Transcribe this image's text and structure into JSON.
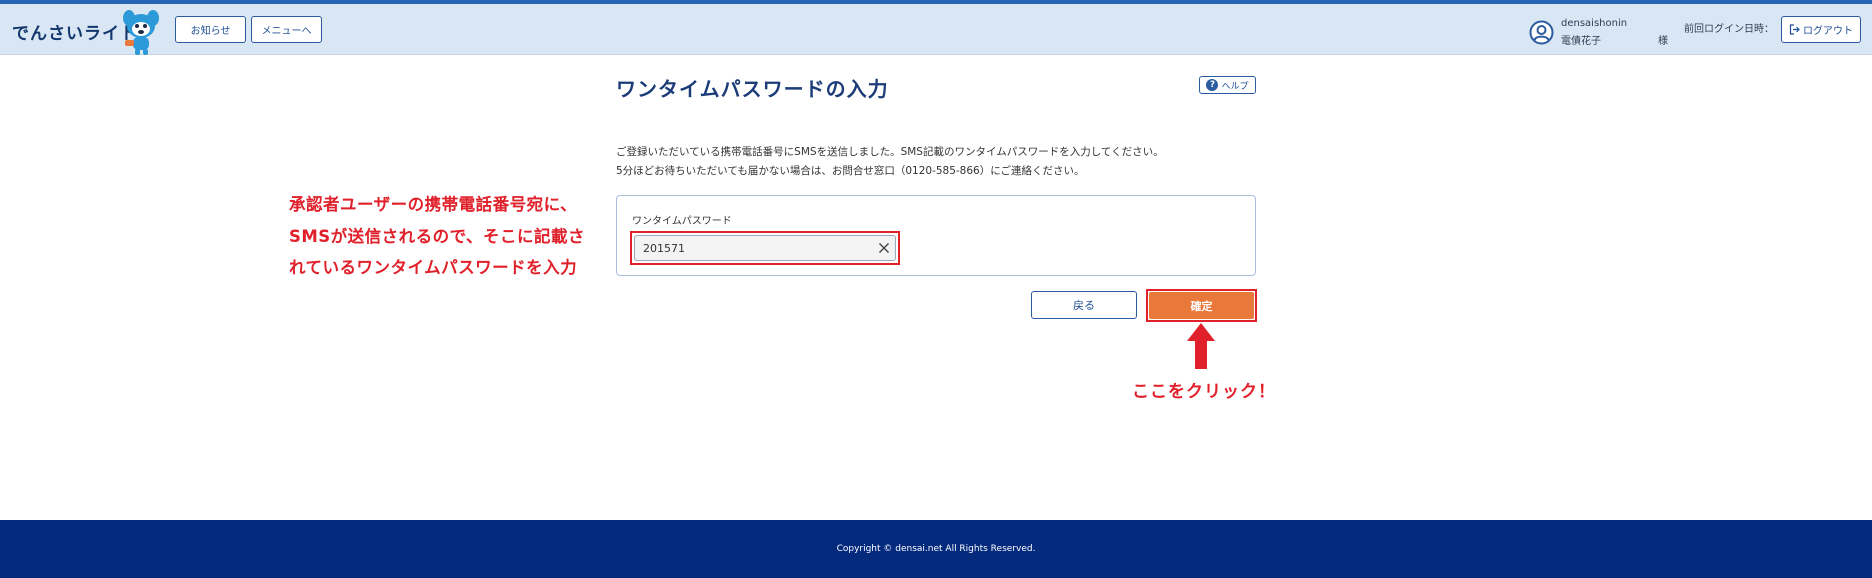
{
  "header": {
    "logo_text": "でんさいライト",
    "news_label": "お知らせ",
    "menu_label": "メニューへ",
    "user_id": "densaishonin",
    "user_name": "電債花子",
    "honorific": "様",
    "last_login_label": "前回ログイン日時：",
    "logout_label": "ログアウト"
  },
  "main": {
    "title": "ワンタイムパスワードの入力",
    "help_label": "ヘルプ",
    "description": [
      "ご登録いただいている携帯電話番号にSMSを送信しました。SMS記載のワンタイムパスワードを入力してください。",
      "5分ほどお待ちいただいても届かない場合は、お問合せ窓口（0120-585-866）にご連絡ください。"
    ],
    "otp_label": "ワンタイムパスワード",
    "otp_value": "201571",
    "back_label": "戻る",
    "confirm_label": "確定"
  },
  "annotations": {
    "instruction_lines": [
      "承認者ユーザーの携帯電話番号宛に、",
      "SMSが送信されるので、そこに記載さ",
      "れているワンタイムパスワードを入力"
    ],
    "click_note": "ここをクリック！"
  },
  "footer": {
    "copyright": "Copyright © densai.net All Rights Reserved."
  },
  "colors": {
    "header_bg": "#d9e6f3",
    "brand_navy": "#042a7d",
    "confirm_orange": "#e8793a",
    "annotation_red": "#e0202a"
  },
  "icons": {
    "mascot": "mascot-character-icon",
    "user": "user-circle-icon",
    "logout": "logout-icon",
    "help": "help-question-icon",
    "clear": "close-icon",
    "arrow": "arrow-up-icon"
  }
}
